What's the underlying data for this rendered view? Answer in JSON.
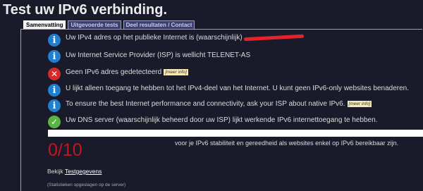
{
  "page": {
    "title": "Test uw IPv6 verbinding."
  },
  "tabs": [
    {
      "label": "Samenvatting",
      "active": true
    },
    {
      "label": "Uitgevoerde tests",
      "active": false
    },
    {
      "label": "Deel resultaten / Contact",
      "active": false
    }
  ],
  "results": [
    {
      "icon": "info-icon",
      "text": "Uw IPv4 adres op het publieke Internet is (waarschijnlijk)"
    },
    {
      "icon": "info-icon",
      "text": "Uw Internet Service Provider (ISP) is wellicht TELENET-AS"
    },
    {
      "icon": "error-icon",
      "text": "Geen IPv6 adres gedetecteerd",
      "more": "[meer info]"
    },
    {
      "icon": "info-icon",
      "text": "U lijkt alleen toegang te hebben tot het IPv4-deel van het Internet. U kunt geen IPv6-only websites benaderen."
    },
    {
      "icon": "info-icon",
      "text": "To ensure the best Internet performance and connectivity, ask your ISP about native IPv6.",
      "more": "[meer info]"
    },
    {
      "icon": "check-icon",
      "text": "Uw DNS server (waarschijnlijk beheerd door uw ISP) lijkt werkende IPv6 internettoegang te hebben."
    }
  ],
  "score": {
    "value": "0/10",
    "fraction": 0,
    "note": "voor je IPv6 stabiliteit en gereedheid als websites enkel op IPv6 bereikbaar zijn."
  },
  "footer": {
    "see_prefix": "Bekijk",
    "see_link": "Testgegevens",
    "stats_note": "(Statistieken opgeslagen op de server)"
  },
  "colors": {
    "background": "#1a1b2a",
    "info": "#1f7fd1",
    "error": "#d8282c",
    "ok": "#5ab443",
    "score": "#c8141b"
  }
}
